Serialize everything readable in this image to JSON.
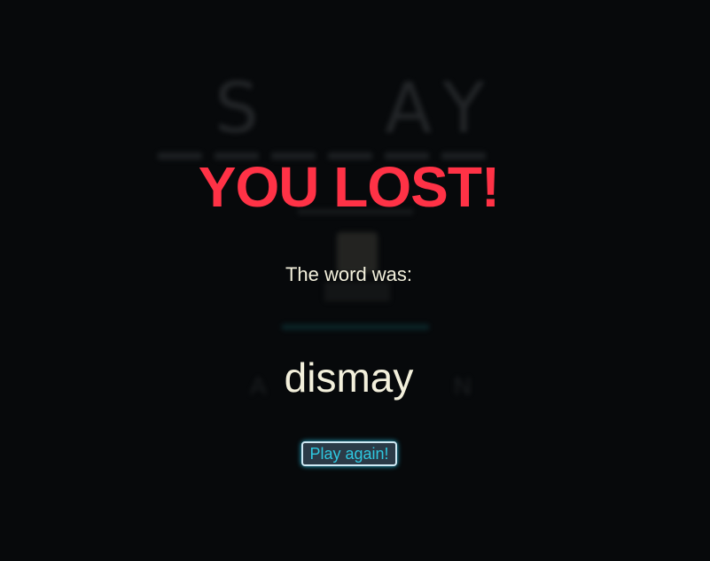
{
  "background_board": {
    "slots": [
      "",
      "S",
      "",
      "",
      "A",
      "Y"
    ],
    "letters": [
      "A",
      "",
      "",
      "",
      "",
      "N"
    ]
  },
  "overlay": {
    "title": "YOU LOST!",
    "subtitle": "The word was:",
    "answer": "dismay",
    "play_again_label": "Play again!"
  },
  "colors": {
    "background": "#07090b",
    "title": "#ff3246",
    "text": "#f3f0dc",
    "button_text": "#2ec8e0",
    "button_glow": "#27b5d6"
  }
}
